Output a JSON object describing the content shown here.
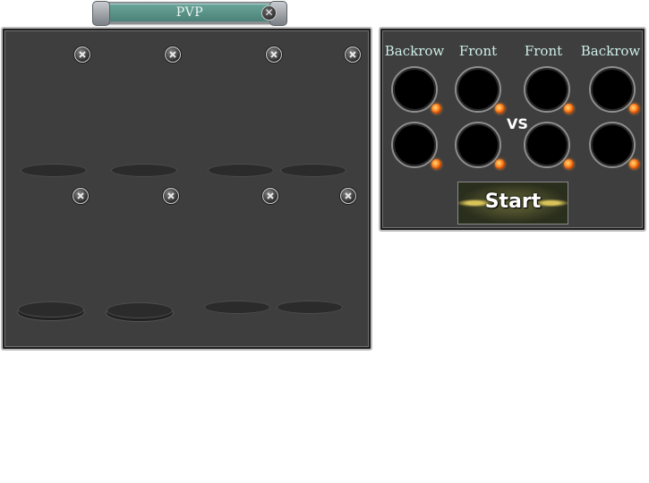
{
  "title": {
    "text": "PVP",
    "close_icon": "close-icon"
  },
  "roster": {
    "remove_icon": "remove-icon",
    "slot_count": 8
  },
  "battle": {
    "columns": [
      "Backrow",
      "Front",
      "Front",
      "Backrow"
    ],
    "vs_text": "VS",
    "start_label": "Start",
    "slot_count": 8
  },
  "colors": {
    "panel_bg": "#3e3e3e",
    "title_bar": "#5b9388",
    "label_text": "#cfeee6",
    "gem": "#ff7b1c"
  }
}
